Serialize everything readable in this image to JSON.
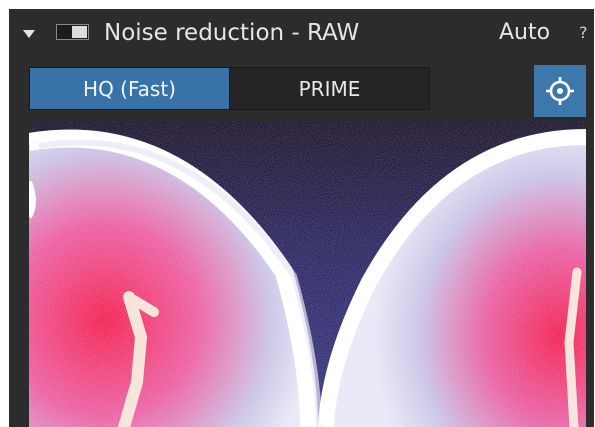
{
  "header": {
    "collapse_icon": "chevron-down-icon",
    "toggle_state": "on",
    "title": "Noise reduction - RAW",
    "auto_label": "Auto",
    "help_label": "?"
  },
  "modes": {
    "items": [
      {
        "label": "HQ (Fast)",
        "active": true
      },
      {
        "label": "PRIME",
        "active": false
      }
    ]
  },
  "picker": {
    "icon": "crosshair-icon"
  },
  "preview": {
    "description_icon": "noise-preview-image"
  },
  "colors": {
    "panel_bg": "#2c2c2c",
    "accent": "#3872a6",
    "text": "#e6e6e6"
  }
}
